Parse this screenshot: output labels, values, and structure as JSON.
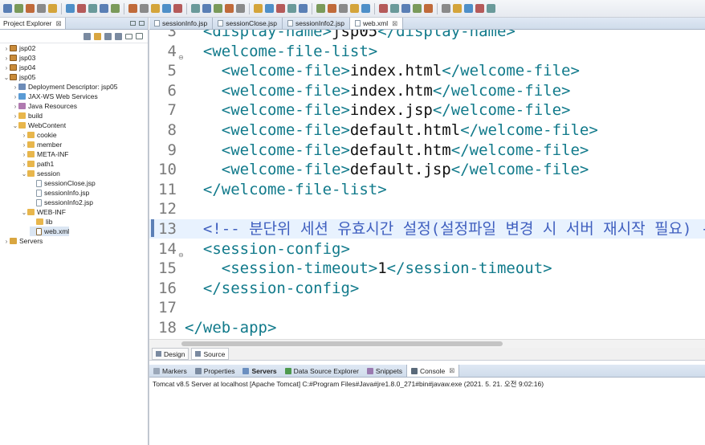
{
  "toolbar": {
    "button_count": 40
  },
  "explorer": {
    "tab_label": "Project Explorer",
    "tab_close": "⊠",
    "tree": [
      {
        "label": "jsp02",
        "depth": 0,
        "arrow": "›",
        "icon": "project"
      },
      {
        "label": "jsp03",
        "depth": 0,
        "arrow": "›",
        "icon": "project"
      },
      {
        "label": "jsp04",
        "depth": 0,
        "arrow": "›",
        "icon": "project"
      },
      {
        "label": "jsp05",
        "depth": 0,
        "arrow": "⌄",
        "icon": "project"
      },
      {
        "label": "Deployment Descriptor: jsp05",
        "depth": 1,
        "arrow": "›",
        "icon": "descr"
      },
      {
        "label": "JAX-WS Web Services",
        "depth": 1,
        "arrow": "›",
        "icon": "ws"
      },
      {
        "label": "Java Resources",
        "depth": 1,
        "arrow": "›",
        "icon": "jres"
      },
      {
        "label": "build",
        "depth": 1,
        "arrow": "›",
        "icon": "folder"
      },
      {
        "label": "WebContent",
        "depth": 1,
        "arrow": "⌄",
        "icon": "folder"
      },
      {
        "label": "cookie",
        "depth": 2,
        "arrow": "›",
        "icon": "folder"
      },
      {
        "label": "member",
        "depth": 2,
        "arrow": "›",
        "icon": "folder"
      },
      {
        "label": "META-INF",
        "depth": 2,
        "arrow": "›",
        "icon": "folder"
      },
      {
        "label": "path1",
        "depth": 2,
        "arrow": "›",
        "icon": "folder"
      },
      {
        "label": "session",
        "depth": 2,
        "arrow": "⌄",
        "icon": "folder"
      },
      {
        "label": "sessionClose.jsp",
        "depth": 3,
        "arrow": "",
        "icon": "file"
      },
      {
        "label": "sessionInfo.jsp",
        "depth": 3,
        "arrow": "",
        "icon": "file"
      },
      {
        "label": "sessionInfo2.jsp",
        "depth": 3,
        "arrow": "",
        "icon": "file"
      },
      {
        "label": "WEB-INF",
        "depth": 2,
        "arrow": "⌄",
        "icon": "folder"
      },
      {
        "label": "lib",
        "depth": 3,
        "arrow": "",
        "icon": "folder"
      },
      {
        "label": "web.xml",
        "depth": 3,
        "arrow": "",
        "icon": "xmlfile",
        "selected": true
      },
      {
        "label": "Servers",
        "depth": 0,
        "arrow": "›",
        "icon": "servers"
      }
    ]
  },
  "editor_tabs": [
    {
      "label": "sessionInfo.jsp",
      "active": false
    },
    {
      "label": "sessionClose.jsp",
      "active": false
    },
    {
      "label": "sessionInfo2.jsp",
      "active": false
    },
    {
      "label": "web.xml",
      "active": true,
      "close": "⊠"
    }
  ],
  "editor": {
    "lines": [
      {
        "n": "3",
        "parts": [
          [
            "tag",
            "  <display-name>"
          ],
          [
            "txt",
            "jsp05"
          ],
          [
            "tag",
            "</display-name>"
          ]
        ]
      },
      {
        "n": "4",
        "fold": "⊖",
        "parts": [
          [
            "tag",
            "  <welcome-file-list>"
          ]
        ]
      },
      {
        "n": "5",
        "parts": [
          [
            "tag",
            "    <welcome-file>"
          ],
          [
            "txt",
            "index.html"
          ],
          [
            "tag",
            "</welcome-file>"
          ]
        ]
      },
      {
        "n": "6",
        "parts": [
          [
            "tag",
            "    <welcome-file>"
          ],
          [
            "txt",
            "index.htm"
          ],
          [
            "tag",
            "</welcome-file>"
          ]
        ]
      },
      {
        "n": "7",
        "parts": [
          [
            "tag",
            "    <welcome-file>"
          ],
          [
            "txt",
            "index.jsp"
          ],
          [
            "tag",
            "</welcome-file>"
          ]
        ]
      },
      {
        "n": "8",
        "parts": [
          [
            "tag",
            "    <welcome-file>"
          ],
          [
            "txt",
            "default.html"
          ],
          [
            "tag",
            "</welcome-file>"
          ]
        ]
      },
      {
        "n": "9",
        "parts": [
          [
            "tag",
            "    <welcome-file>"
          ],
          [
            "txt",
            "default.htm"
          ],
          [
            "tag",
            "</welcome-file>"
          ]
        ]
      },
      {
        "n": "10",
        "parts": [
          [
            "tag",
            "    <welcome-file>"
          ],
          [
            "txt",
            "default.jsp"
          ],
          [
            "tag",
            "</welcome-file>"
          ]
        ]
      },
      {
        "n": "11",
        "parts": [
          [
            "tag",
            "  </welcome-file-list>"
          ]
        ]
      },
      {
        "n": "12",
        "parts": []
      },
      {
        "n": "13",
        "current": true,
        "parts": [
          [
            "cm",
            "  <!-- 분단위 세션 유효시간 설정(설정파일 변경 시 서버 재시작 필요) -->"
          ]
        ]
      },
      {
        "n": "14",
        "fold": "⊖",
        "parts": [
          [
            "tag",
            "  <session-config>"
          ]
        ]
      },
      {
        "n": "15",
        "parts": [
          [
            "tag",
            "    <session-timeout>"
          ],
          [
            "txt",
            "1"
          ],
          [
            "tag",
            "</session-timeout>"
          ]
        ]
      },
      {
        "n": "16",
        "parts": [
          [
            "tag",
            "  </session-config>"
          ]
        ]
      },
      {
        "n": "17",
        "parts": []
      },
      {
        "n": "18",
        "parts": [
          [
            "tag",
            "</web-app>"
          ]
        ]
      }
    ]
  },
  "mode_tabs": [
    {
      "label": "Design",
      "active": false
    },
    {
      "label": "Source",
      "active": true
    }
  ],
  "bottom_tabs": [
    {
      "label": "Markers",
      "bold": false,
      "color": "#9aa7b8"
    },
    {
      "label": "Properties",
      "bold": false,
      "color": "#7a8aa0"
    },
    {
      "label": "Servers",
      "bold": true,
      "color": "#6b8fc0"
    },
    {
      "label": "Data Source Explorer",
      "bold": false,
      "color": "#4e9a4e"
    },
    {
      "label": "Snippets",
      "bold": false,
      "color": "#9a7ab0"
    },
    {
      "label": "Console",
      "bold": false,
      "color": "#5a6a7a",
      "active": true,
      "close": "⊠"
    }
  ],
  "console": {
    "status": "Tomcat v8.5 Server at localhost [Apache Tomcat] C:#Program Files#Java#jre1.8.0_271#bin#javaw.exe  (2021. 5. 21. 오전 9:02:16)"
  }
}
